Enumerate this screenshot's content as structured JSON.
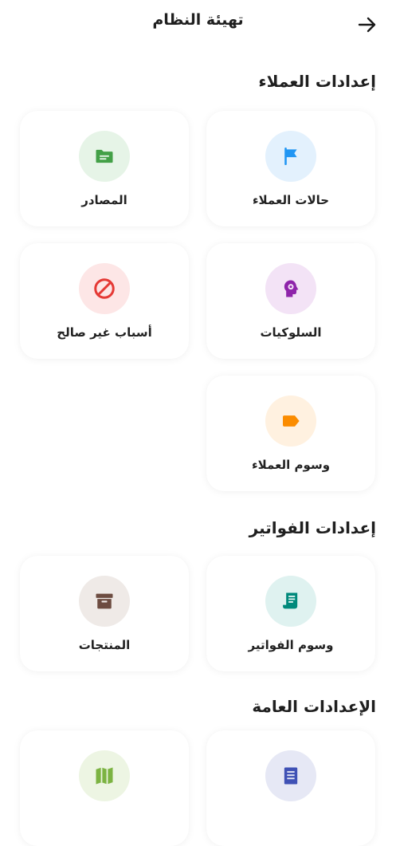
{
  "header": {
    "title": "تهيئة النظام",
    "back_icon": "arrow-right-icon"
  },
  "sections": {
    "customers": {
      "title": "إعدادات العملاء",
      "cards": [
        {
          "label": "حالات العملاء",
          "icon": "flag-icon",
          "color": "#2196F3",
          "bg": "#E3F1FD"
        },
        {
          "label": "المصادر",
          "icon": "folder-icon",
          "color": "#43A047",
          "bg": "#E6F4E7"
        },
        {
          "label": "السلوكيات",
          "icon": "head-gear-icon",
          "color": "#8E24AA",
          "bg": "#F3E3F6"
        },
        {
          "label": "أسباب غير صالح",
          "icon": "block-icon",
          "color": "#E53935",
          "bg": "#FDE6E6"
        },
        {
          "label": "وسوم العملاء",
          "icon": "tag-icon",
          "color": "#FB8C00",
          "bg": "#FFF1E0"
        }
      ]
    },
    "invoices": {
      "title": "إعدادات الفواتير",
      "cards": [
        {
          "label": "وسوم الفواتير",
          "icon": "receipt-icon",
          "color": "#00897B",
          "bg": "#DFF2F0"
        },
        {
          "label": "المنتجات",
          "icon": "archive-box-icon",
          "color": "#6D4C41",
          "bg": "#EFEAE7"
        }
      ]
    },
    "general": {
      "title": "الإعدادات العامة",
      "cards": [
        {
          "icon": "document-icon",
          "color": "#3F51B5",
          "bg": "#E6E8F5"
        },
        {
          "icon": "map-icon",
          "color": "#7CB342",
          "bg": "#EDF5E3"
        }
      ]
    }
  }
}
